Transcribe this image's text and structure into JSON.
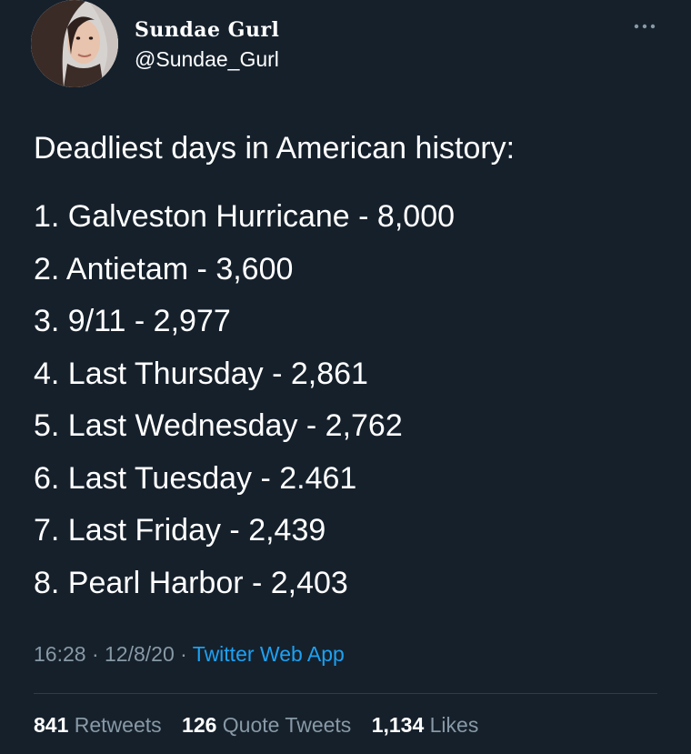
{
  "user": {
    "display_name": "Sundae Gurl",
    "handle": "@Sundae_Gurl"
  },
  "tweet": {
    "heading": "Deadliest days in American history:",
    "items": [
      "1. Galveston Hurricane - 8,000",
      "2. Antietam - 3,600",
      "3. 9/11 - 2,977",
      "4. Last Thursday - 2,861",
      "5. Last Wednesday - 2,762",
      "6. Last Tuesday - 2.461",
      "7.  Last Friday - 2,439",
      "8. Pearl Harbor - 2,403"
    ],
    "time": "16:28",
    "date": "12/8/20",
    "separator": " · ",
    "source": "Twitter Web App"
  },
  "stats": {
    "retweets_count": "841",
    "retweets_label": "Retweets",
    "quote_count": "126",
    "quote_label": "Quote Tweets",
    "likes_count": "1,134",
    "likes_label": "Likes"
  },
  "colors": {
    "background": "#15202b",
    "text": "#ffffff",
    "secondary": "#8899a6",
    "accent": "#1da1f2"
  },
  "icons": {
    "more": "more-horizontal-icon"
  }
}
